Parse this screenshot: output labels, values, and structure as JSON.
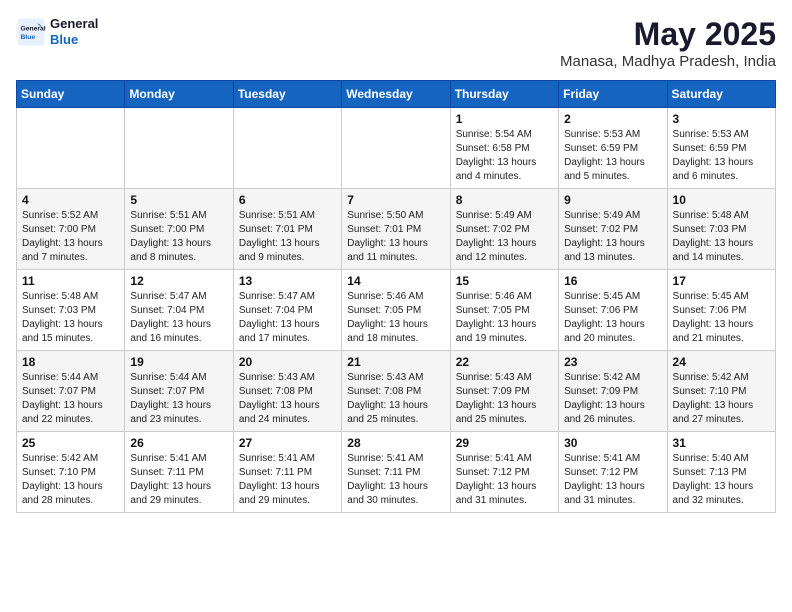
{
  "header": {
    "logo_line1": "General",
    "logo_line2": "Blue",
    "month_year": "May 2025",
    "location": "Manasa, Madhya Pradesh, India"
  },
  "days_of_week": [
    "Sunday",
    "Monday",
    "Tuesday",
    "Wednesday",
    "Thursday",
    "Friday",
    "Saturday"
  ],
  "weeks": [
    [
      {
        "day": "",
        "info": ""
      },
      {
        "day": "",
        "info": ""
      },
      {
        "day": "",
        "info": ""
      },
      {
        "day": "",
        "info": ""
      },
      {
        "day": "1",
        "info": "Sunrise: 5:54 AM\nSunset: 6:58 PM\nDaylight: 13 hours\nand 4 minutes."
      },
      {
        "day": "2",
        "info": "Sunrise: 5:53 AM\nSunset: 6:59 PM\nDaylight: 13 hours\nand 5 minutes."
      },
      {
        "day": "3",
        "info": "Sunrise: 5:53 AM\nSunset: 6:59 PM\nDaylight: 13 hours\nand 6 minutes."
      }
    ],
    [
      {
        "day": "4",
        "info": "Sunrise: 5:52 AM\nSunset: 7:00 PM\nDaylight: 13 hours\nand 7 minutes."
      },
      {
        "day": "5",
        "info": "Sunrise: 5:51 AM\nSunset: 7:00 PM\nDaylight: 13 hours\nand 8 minutes."
      },
      {
        "day": "6",
        "info": "Sunrise: 5:51 AM\nSunset: 7:01 PM\nDaylight: 13 hours\nand 9 minutes."
      },
      {
        "day": "7",
        "info": "Sunrise: 5:50 AM\nSunset: 7:01 PM\nDaylight: 13 hours\nand 11 minutes."
      },
      {
        "day": "8",
        "info": "Sunrise: 5:49 AM\nSunset: 7:02 PM\nDaylight: 13 hours\nand 12 minutes."
      },
      {
        "day": "9",
        "info": "Sunrise: 5:49 AM\nSunset: 7:02 PM\nDaylight: 13 hours\nand 13 minutes."
      },
      {
        "day": "10",
        "info": "Sunrise: 5:48 AM\nSunset: 7:03 PM\nDaylight: 13 hours\nand 14 minutes."
      }
    ],
    [
      {
        "day": "11",
        "info": "Sunrise: 5:48 AM\nSunset: 7:03 PM\nDaylight: 13 hours\nand 15 minutes."
      },
      {
        "day": "12",
        "info": "Sunrise: 5:47 AM\nSunset: 7:04 PM\nDaylight: 13 hours\nand 16 minutes."
      },
      {
        "day": "13",
        "info": "Sunrise: 5:47 AM\nSunset: 7:04 PM\nDaylight: 13 hours\nand 17 minutes."
      },
      {
        "day": "14",
        "info": "Sunrise: 5:46 AM\nSunset: 7:05 PM\nDaylight: 13 hours\nand 18 minutes."
      },
      {
        "day": "15",
        "info": "Sunrise: 5:46 AM\nSunset: 7:05 PM\nDaylight: 13 hours\nand 19 minutes."
      },
      {
        "day": "16",
        "info": "Sunrise: 5:45 AM\nSunset: 7:06 PM\nDaylight: 13 hours\nand 20 minutes."
      },
      {
        "day": "17",
        "info": "Sunrise: 5:45 AM\nSunset: 7:06 PM\nDaylight: 13 hours\nand 21 minutes."
      }
    ],
    [
      {
        "day": "18",
        "info": "Sunrise: 5:44 AM\nSunset: 7:07 PM\nDaylight: 13 hours\nand 22 minutes."
      },
      {
        "day": "19",
        "info": "Sunrise: 5:44 AM\nSunset: 7:07 PM\nDaylight: 13 hours\nand 23 minutes."
      },
      {
        "day": "20",
        "info": "Sunrise: 5:43 AM\nSunset: 7:08 PM\nDaylight: 13 hours\nand 24 minutes."
      },
      {
        "day": "21",
        "info": "Sunrise: 5:43 AM\nSunset: 7:08 PM\nDaylight: 13 hours\nand 25 minutes."
      },
      {
        "day": "22",
        "info": "Sunrise: 5:43 AM\nSunset: 7:09 PM\nDaylight: 13 hours\nand 25 minutes."
      },
      {
        "day": "23",
        "info": "Sunrise: 5:42 AM\nSunset: 7:09 PM\nDaylight: 13 hours\nand 26 minutes."
      },
      {
        "day": "24",
        "info": "Sunrise: 5:42 AM\nSunset: 7:10 PM\nDaylight: 13 hours\nand 27 minutes."
      }
    ],
    [
      {
        "day": "25",
        "info": "Sunrise: 5:42 AM\nSunset: 7:10 PM\nDaylight: 13 hours\nand 28 minutes."
      },
      {
        "day": "26",
        "info": "Sunrise: 5:41 AM\nSunset: 7:11 PM\nDaylight: 13 hours\nand 29 minutes."
      },
      {
        "day": "27",
        "info": "Sunrise: 5:41 AM\nSunset: 7:11 PM\nDaylight: 13 hours\nand 29 minutes."
      },
      {
        "day": "28",
        "info": "Sunrise: 5:41 AM\nSunset: 7:11 PM\nDaylight: 13 hours\nand 30 minutes."
      },
      {
        "day": "29",
        "info": "Sunrise: 5:41 AM\nSunset: 7:12 PM\nDaylight: 13 hours\nand 31 minutes."
      },
      {
        "day": "30",
        "info": "Sunrise: 5:41 AM\nSunset: 7:12 PM\nDaylight: 13 hours\nand 31 minutes."
      },
      {
        "day": "31",
        "info": "Sunrise: 5:40 AM\nSunset: 7:13 PM\nDaylight: 13 hours\nand 32 minutes."
      }
    ]
  ]
}
